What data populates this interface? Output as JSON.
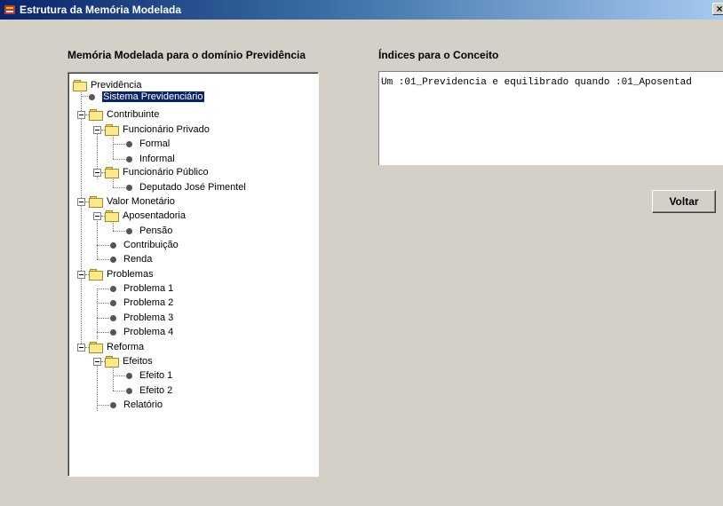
{
  "window": {
    "title": "Estrutura da Memória Modelada",
    "close_glyph": "×"
  },
  "left_section": {
    "label": "Memória Modelada para o domínio Previdência"
  },
  "right_section": {
    "label": "Índices para o Conceito",
    "index_text": "Um :01_Previdencia e equilibrado quando :01_Aposentad"
  },
  "buttons": {
    "voltar": "Voltar"
  },
  "tree": {
    "previdencia": "Previdência",
    "sistema": "Sistema Previdenciário",
    "contribuinte": "Contribuinte",
    "func_privado": "Funcionário Privado",
    "formal": "Formal",
    "informal": "Informal",
    "func_publico": "Funcionário Público",
    "deputado": "Deputado José Pimentel",
    "valor_monetario": "Valor Monetário",
    "aposentadoria": "Aposentadoria",
    "pensao": "Pensão",
    "contribuicao": "Contribuição",
    "renda": "Renda",
    "problemas": "Problemas",
    "problema1": "Problema 1",
    "problema2": "Problema 2",
    "problema3": "Problema 3",
    "problema4": "Problema 4",
    "reforma": "Reforma",
    "efeitos": "Efeitos",
    "efeito1": "Efeito 1",
    "efeito2": "Efeito 2",
    "relatorio": "Relatório"
  }
}
